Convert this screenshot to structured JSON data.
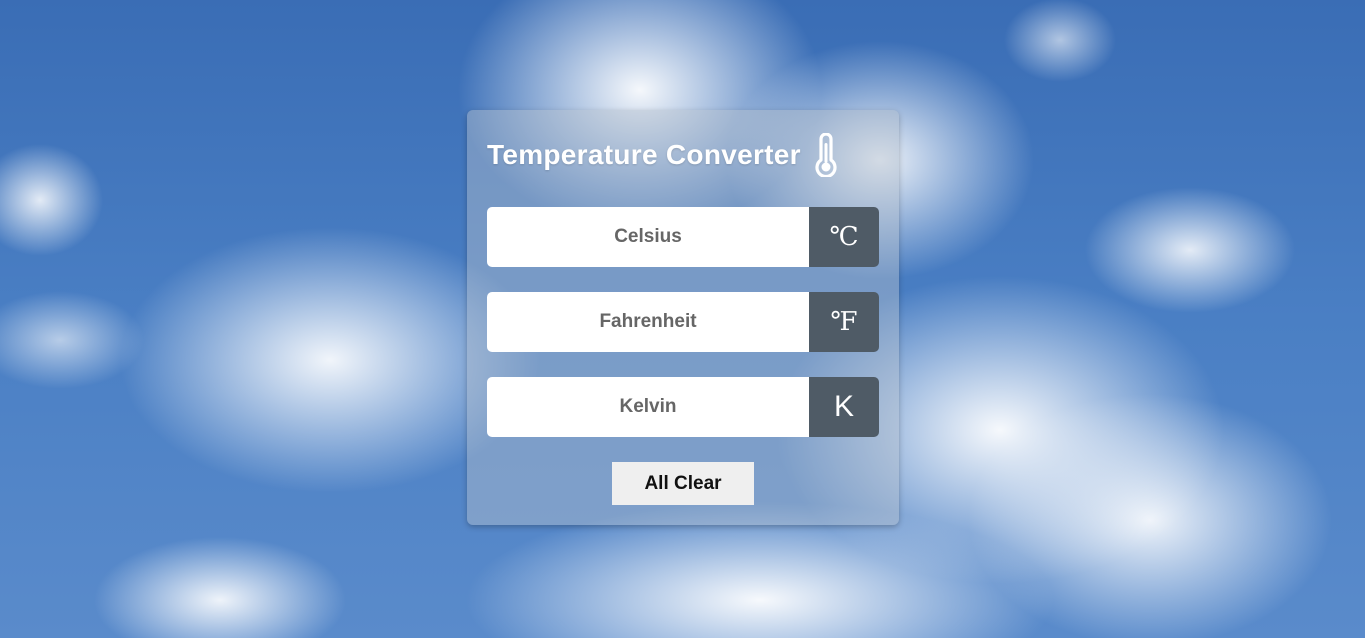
{
  "app": {
    "title": "Temperature Converter",
    "title_icon": "thermometer-icon"
  },
  "fields": [
    {
      "placeholder": "Celsius",
      "value": "",
      "unit": "℃"
    },
    {
      "placeholder": "Fahrenheit",
      "value": "",
      "unit": "℉"
    },
    {
      "placeholder": "Kelvin",
      "value": "",
      "unit": "K"
    }
  ],
  "actions": {
    "clear_label": "All Clear"
  },
  "colors": {
    "unit_badge": "#4f5b66",
    "button_bg": "#efefef",
    "card_bg": "rgba(180,190,205,0.45)"
  }
}
